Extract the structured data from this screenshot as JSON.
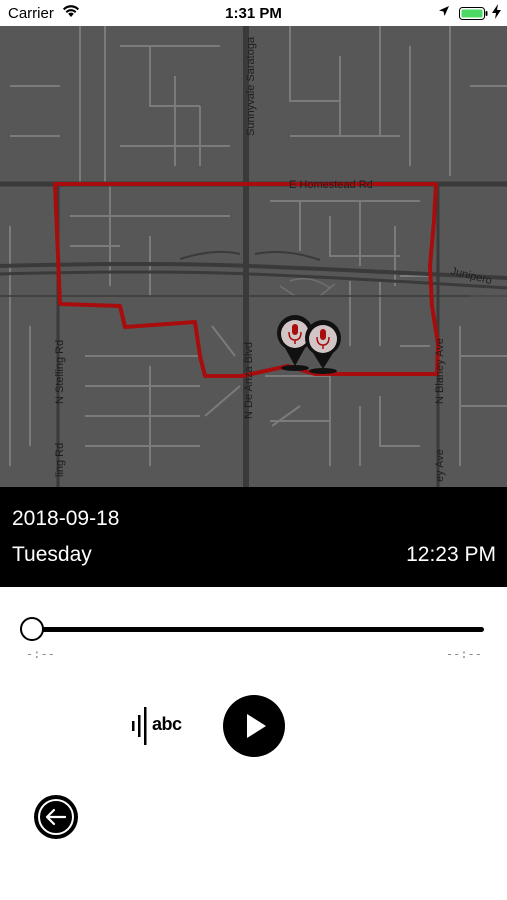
{
  "status_bar": {
    "carrier": "Carrier",
    "time": "1:31 PM",
    "icons": [
      "wifi-icon",
      "location-arrow-icon",
      "battery-icon",
      "charging-bolt-icon"
    ],
    "battery_color": "#4cd964"
  },
  "map": {
    "streets": {
      "homestead": "E Homestead Rd",
      "sunnyvale": "Sunnyvale Saratoga",
      "junipero": "Junipero",
      "stelling": "N Stelling Rd",
      "stelling_lower": "ling Rd",
      "de_anza": "N De Anza Blvd",
      "blaney": "N Blaney Ave",
      "blaney_lower": "ey Ave"
    },
    "route_color": "#a80c0c",
    "markers": [
      "microphone-pin-icon",
      "microphone-pin-icon"
    ]
  },
  "recording": {
    "date": "2018-09-18",
    "weekday": "Tuesday",
    "time": "12:23 PM"
  },
  "player": {
    "progress": 0,
    "elapsed": "-:--",
    "remaining": "--:--",
    "transcribe_label": "abc"
  }
}
